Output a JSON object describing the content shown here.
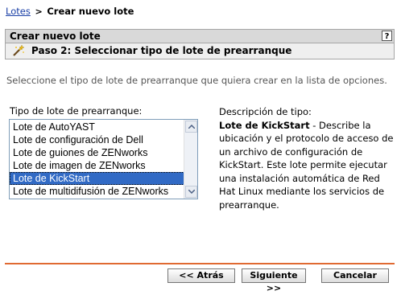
{
  "breadcrumb": {
    "root": "Lotes",
    "current": "Crear nuevo lote"
  },
  "panel": {
    "title": "Crear nuevo lote",
    "help": "?",
    "step_title": "Paso 2: Seleccionar tipo de lote de prearranque"
  },
  "instructions": "Seleccione el tipo de lote de prearranque que quiera crear en la lista de opciones.",
  "list": {
    "label": "Tipo de lote de prearranque:",
    "items": [
      "Lote de AutoYAST",
      "Lote de configuración de Dell",
      "Lote de guiones de ZENworks",
      "Lote de imagen de ZENworks",
      "Lote de KickStart",
      "Lote de multidifusión de ZENworks"
    ],
    "selected_index": 4
  },
  "description": {
    "label": "Descripción de tipo:",
    "name": "Lote de KickStart",
    "text": " - Describe la ubicación y el protocolo de acceso de un archivo de configuración de KickStart. Este lote permite ejecutar una instalación automática de Red Hat Linux mediante los servicios de prearranque."
  },
  "buttons": {
    "back": "<< Atrás",
    "next": "Siguiente >>",
    "cancel": "Cancelar"
  },
  "colors": {
    "accent_divider": "#e06a32",
    "selection": "#316ac5",
    "link": "#1a3fa6"
  }
}
